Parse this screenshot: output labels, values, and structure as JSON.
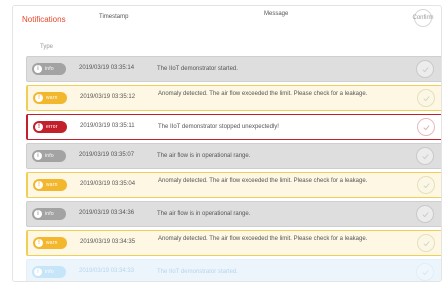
{
  "panel": {
    "title": "Notifications"
  },
  "columns": {
    "type": "Type",
    "timestamp": "Timestamp",
    "message": "Message",
    "confirm": "Confirm"
  },
  "colors": {
    "accent": "#e8452d",
    "info": "#a3a3a3",
    "warning": "#f3b72e",
    "error": "#c4202b"
  },
  "rows": [
    {
      "kind": "info",
      "icon": "info-icon",
      "type_label": "info",
      "timestamp": "2019/03/19 03:35:14",
      "message": "The IIoT demonstrator started."
    },
    {
      "kind": "warn",
      "icon": "warning-icon",
      "type_label": "warn",
      "timestamp": "2019/03/19 03:35:12",
      "message": "Anomaly detected. The air flow exceeded the limit. Please check for a leakage."
    },
    {
      "kind": "err",
      "icon": "error-icon",
      "type_label": "error",
      "timestamp": "2019/03/19 03:35:11",
      "message": "The IIoT demonstrator stopped unexpectedly!"
    },
    {
      "kind": "info",
      "icon": "info-icon",
      "type_label": "info",
      "timestamp": "2019/03/19 03:35:07",
      "message": "The air flow is in operational range."
    },
    {
      "kind": "warn",
      "icon": "warning-icon",
      "type_label": "warn",
      "timestamp": "2019/03/19 03:35:04",
      "message": "Anomaly detected. The air flow exceeded the limit. Please check for a leakage."
    },
    {
      "kind": "info",
      "icon": "info-icon",
      "type_label": "info",
      "timestamp": "2019/03/19 03:34:36",
      "message": "The air flow is in operational range."
    },
    {
      "kind": "warn",
      "icon": "warning-icon",
      "type_label": "warn",
      "timestamp": "2019/03/19 03:34:35",
      "message": "Anomaly detected. The air flow exceeded the limit. Please check for a leakage."
    },
    {
      "kind": "faded",
      "icon": "info-icon",
      "type_label": "info",
      "timestamp": "2019/03/19 03:34:33",
      "message": "The IIoT demonstrator started."
    }
  ]
}
